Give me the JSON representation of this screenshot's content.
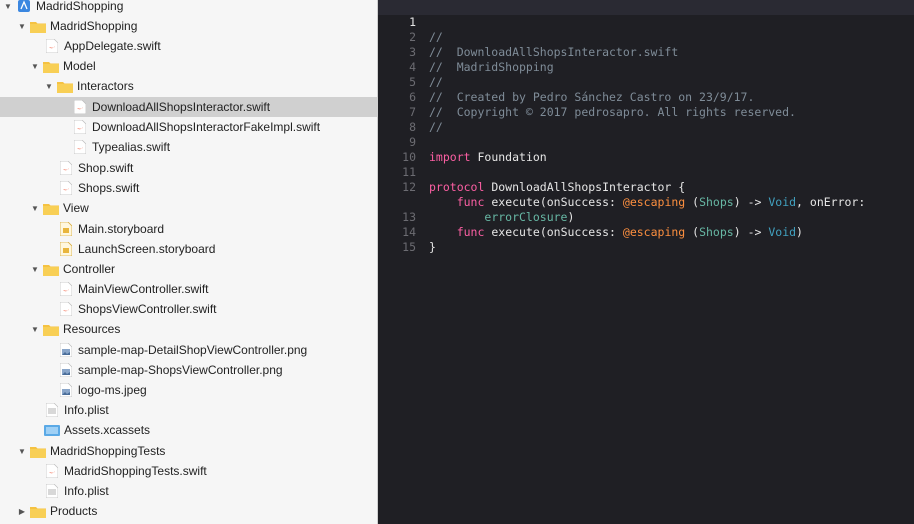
{
  "navigator": {
    "items": [
      {
        "label": "MadridShopping",
        "icon": "project-icon",
        "expanded": true
      },
      {
        "label": "MadridShopping",
        "icon": "folder-icon",
        "expanded": true
      },
      {
        "label": "AppDelegate.swift",
        "icon": "swift-file-icon"
      },
      {
        "label": "Model",
        "icon": "folder-icon",
        "expanded": true
      },
      {
        "label": "Interactors",
        "icon": "folder-icon",
        "expanded": true
      },
      {
        "label": "DownloadAllShopsInteractor.swift",
        "icon": "swift-file-icon",
        "selected": true
      },
      {
        "label": "DownloadAllShopsInteractorFakeImpl.swift",
        "icon": "swift-file-icon"
      },
      {
        "label": "Typealias.swift",
        "icon": "swift-file-icon"
      },
      {
        "label": "Shop.swift",
        "icon": "swift-file-icon"
      },
      {
        "label": "Shops.swift",
        "icon": "swift-file-icon"
      },
      {
        "label": "View",
        "icon": "folder-icon",
        "expanded": true
      },
      {
        "label": "Main.storyboard",
        "icon": "storyboard-icon"
      },
      {
        "label": "LaunchScreen.storyboard",
        "icon": "storyboard-icon"
      },
      {
        "label": "Controller",
        "icon": "folder-icon",
        "expanded": true
      },
      {
        "label": "MainViewController.swift",
        "icon": "swift-file-icon"
      },
      {
        "label": "ShopsViewController.swift",
        "icon": "swift-file-icon"
      },
      {
        "label": "Resources",
        "icon": "folder-icon",
        "expanded": true
      },
      {
        "label": "sample-map-DetailShopViewController.png",
        "icon": "image-file-icon"
      },
      {
        "label": "sample-map-ShopsViewController.png",
        "icon": "image-file-icon"
      },
      {
        "label": "logo-ms.jpeg",
        "icon": "image-file-icon"
      },
      {
        "label": "Info.plist",
        "icon": "plist-file-icon"
      },
      {
        "label": "Assets.xcassets",
        "icon": "asset-catalog-icon"
      },
      {
        "label": "MadridShoppingTests",
        "icon": "folder-icon",
        "expanded": true
      },
      {
        "label": "MadridShoppingTests.swift",
        "icon": "swift-file-icon"
      },
      {
        "label": "Info.plist",
        "icon": "plist-file-icon"
      },
      {
        "label": "Products",
        "icon": "folder-icon",
        "expanded": false
      }
    ]
  },
  "editor": {
    "line_numbers": [
      "1",
      "2",
      "3",
      "4",
      "5",
      "6",
      "7",
      "8",
      "9",
      "10",
      "11",
      "12",
      "13",
      "14",
      "15"
    ],
    "code": {
      "l1": "//",
      "l2": "//  DownloadAllShopsInteractor.swift",
      "l3": "//  MadridShopping",
      "l4": "//",
      "l5": "//  Created by Pedro Sánchez Castro on 23/9/17.",
      "l6": "//  Copyright © 2017 pedrosapro. All rights reserved.",
      "l7": "//",
      "kw_import": "import",
      "mod_foundation": "Foundation",
      "kw_protocol": "protocol",
      "proto_name": "DownloadAllShopsInteractor",
      "brace_open": " {",
      "kw_func": "func",
      "fn_execute": "execute",
      "on_success": "(onSuccess: ",
      "attr_escaping": "@escaping",
      "type_shops": "Shops",
      "arrow": " -> ",
      "type_void": "Void",
      "on_error": ", onError:",
      "error_closure": "errorClosure",
      "close_paren": ")",
      "brace_close": "}"
    }
  },
  "colors": {
    "comment": "#7f8c98",
    "keyword": "#fc5fa3",
    "attribute": "#fd8f3f",
    "type": "#41a1c0",
    "project_type": "#67b7a4",
    "folder": "#f5c242",
    "editor_bg": "#1f1f24"
  }
}
